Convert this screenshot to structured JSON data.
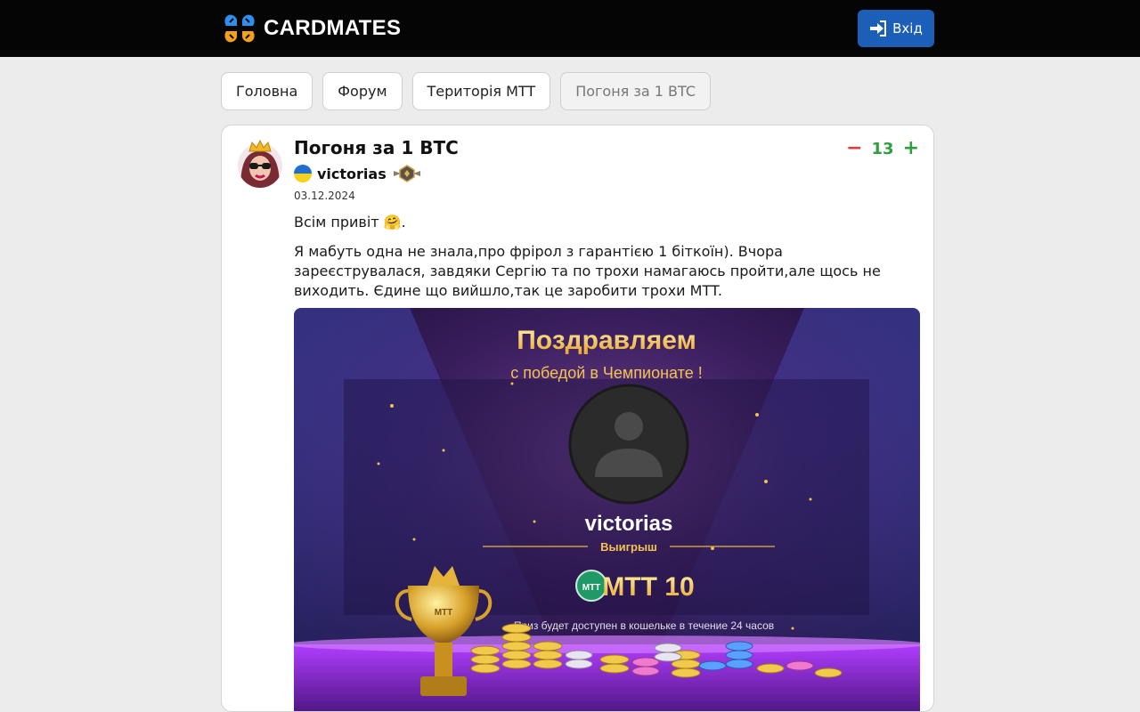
{
  "header": {
    "logo_text": "CARDMATES",
    "login_label": "Вхід"
  },
  "nav": {
    "items": [
      {
        "label": "Головна",
        "active": false
      },
      {
        "label": "Форум",
        "active": false
      },
      {
        "label": "Територія MTT",
        "active": false
      },
      {
        "label": "Погоня за 1 BTC",
        "active": true
      }
    ]
  },
  "post": {
    "title": "Погоня за 1 BTC",
    "author": "victorias",
    "author_flag": "ukraine-flag-icon",
    "rank_icon": "rank-badge-icon",
    "date": "03.12.2024",
    "votes": {
      "down_symbol": "−",
      "count": "13",
      "up_symbol": "+"
    },
    "paragraphs": [
      "Всім привіт 🤗.",
      "Я мабуть одна не знала,про фрірол з гарантією 1 біткоїн). Вчора зареєструвалася, завдяки Сергію та по трохи намагаюсь пройти,але щось не виходить. Єдине що вийшло,так це заробити трохи MTT."
    ],
    "image": {
      "headline": "Поздравляем",
      "subheadline": "с победой в Чемпионате !",
      "winner_name": "victorias",
      "prize_label": "Выигрыш",
      "prize_badge": "MTT",
      "prize_amount": "MTT 10",
      "note": "Приз будет доступен в кошельке в течение 24 часов"
    }
  },
  "colors": {
    "topbar": "#050505",
    "login_button": "#1c5fb8",
    "vote_down": "#e53935",
    "vote_up": "#2e9e3e",
    "gold": "#f3c14e"
  }
}
